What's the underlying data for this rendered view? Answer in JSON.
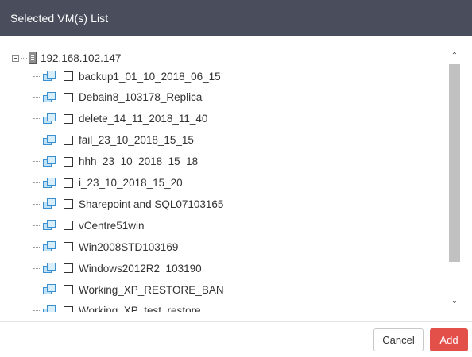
{
  "dialog": {
    "title": "Selected VM(s) List"
  },
  "tree": {
    "root": {
      "label": "192.168.102.147",
      "icon": "server-icon",
      "expanded": true
    },
    "items": [
      {
        "label": "backup1_01_10_2018_06_15",
        "checked": false
      },
      {
        "label": "Debain8_103178_Replica",
        "checked": false
      },
      {
        "label": "delete_14_11_2018_11_40",
        "checked": false
      },
      {
        "label": "fail_23_10_2018_15_15",
        "checked": false
      },
      {
        "label": "hhh_23_10_2018_15_18",
        "checked": false
      },
      {
        "label": "i_23_10_2018_15_20",
        "checked": false
      },
      {
        "label": "Sharepoint and SQL07103165",
        "checked": false
      },
      {
        "label": "vCentre51win",
        "checked": false
      },
      {
        "label": "Win2008STD103169",
        "checked": false
      },
      {
        "label": "Windows2012R2_103190",
        "checked": false
      },
      {
        "label": "Working_XP_RESTORE_BAN",
        "checked": false
      },
      {
        "label": "Working_XP_test_restore",
        "checked": false
      }
    ]
  },
  "scroll": {
    "up_glyph": "⌃",
    "down_glyph": "⌄"
  },
  "footer": {
    "cancel_label": "Cancel",
    "add_label": "Add"
  },
  "colors": {
    "header_bg": "#4a4e5c",
    "add_button": "#e3504a",
    "vm_icon": "#3a8fd0"
  }
}
